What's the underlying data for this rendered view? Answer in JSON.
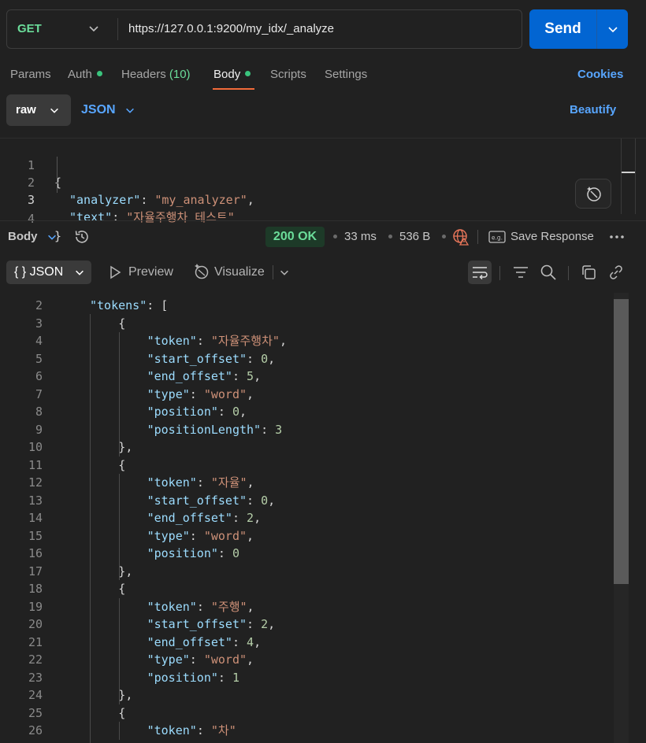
{
  "request": {
    "method": "GET",
    "url": "https://127.0.0.1:9200/my_idx/_analyze",
    "send_label": "Send"
  },
  "tabs": {
    "params": "Params",
    "auth": "Auth",
    "headers": "Headers",
    "headers_count": "(10)",
    "body": "Body",
    "scripts": "Scripts",
    "settings": "Settings",
    "cookies": "Cookies"
  },
  "body_mode": {
    "raw": "raw",
    "format": "JSON",
    "beautify": "Beautify"
  },
  "request_body": {
    "line_numbers": [
      "1",
      "2",
      "3",
      "4"
    ],
    "open_brace": "{",
    "analyzer_key": "\"analyzer\"",
    "analyzer_value": "\"my_analyzer\"",
    "text_key": "\"text\"",
    "text_value": "\"자율주행차 테스트\"",
    "close_brace": "}"
  },
  "response": {
    "section_label": "Body",
    "status": "200 OK",
    "time": "33 ms",
    "size": "536 B",
    "save_response": "Save Response",
    "view_format": "{ } JSON",
    "preview": "Preview",
    "visualize": "Visualize"
  },
  "response_body": {
    "tokens_key": "\"tokens\"",
    "objects": [
      {
        "token": "\"자율주행차\"",
        "start_offset": "0",
        "end_offset": "5",
        "type": "\"word\"",
        "position": "0",
        "positionLength": "3"
      },
      {
        "token": "\"자율\"",
        "start_offset": "0",
        "end_offset": "2",
        "type": "\"word\"",
        "position": "0"
      },
      {
        "token": "\"주행\"",
        "start_offset": "2",
        "end_offset": "4",
        "type": "\"word\"",
        "position": "1"
      },
      {
        "token": "\"차\""
      }
    ]
  },
  "colors": {
    "accent_blue": "#0265d2",
    "link_blue": "#58a6ff",
    "method_green": "#6bdd9a",
    "json_key": "#9cdcfe",
    "json_string": "#ce9178",
    "json_number": "#b5cea8",
    "tab_underline": "#f26b3a"
  }
}
